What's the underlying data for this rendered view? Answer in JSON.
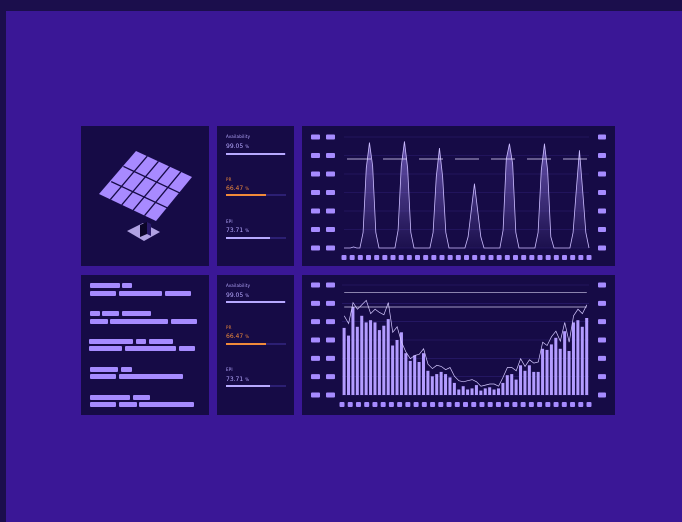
{
  "metrics_top": [
    {
      "label": "Availability",
      "value": "99.05",
      "unit": "%",
      "fraction": 0.9905,
      "accent": "#b7a9ff"
    },
    {
      "label": "PR",
      "value": "66.47",
      "unit": "%",
      "fraction": 0.6647,
      "accent": "#f08a3a"
    },
    {
      "label": "EPI",
      "value": "73.71",
      "unit": "%",
      "fraction": 0.7371,
      "accent": "#b7a9ff"
    }
  ],
  "metrics_bottom": [
    {
      "label": "Availability",
      "value": "99.05",
      "unit": "%",
      "fraction": 0.9905,
      "accent": "#b7a9ff"
    },
    {
      "label": "PR",
      "value": "66.47",
      "unit": "%",
      "fraction": 0.6647,
      "accent": "#f08a3a"
    },
    {
      "label": "EPI",
      "value": "73.71",
      "unit": "%",
      "fraction": 0.7371,
      "accent": "#b7a9ff"
    }
  ],
  "colors": {
    "background": "#3a1796",
    "panel": "#160b46",
    "accent": "#a68bff",
    "orange": "#f08a3a"
  },
  "icons": {
    "solar_array": "solar-panel-array-icon"
  },
  "chart_data": [
    {
      "type": "area",
      "series": [
        {
          "values": [
            0,
            0,
            0,
            1,
            0,
            0,
            14,
            72,
            95,
            74,
            14,
            0,
            0,
            0,
            0,
            0,
            0,
            16,
            74,
            96,
            72,
            14,
            0,
            0,
            0,
            0,
            0,
            0,
            14,
            64,
            90,
            64,
            14,
            0,
            0,
            0,
            0,
            0,
            0,
            10,
            34,
            58,
            34,
            10,
            0,
            0,
            0,
            0,
            0,
            0,
            16,
            80,
            94,
            76,
            14,
            0,
            0,
            0,
            0,
            0,
            0,
            14,
            70,
            94,
            70,
            10,
            0,
            0,
            0,
            0,
            0,
            0,
            14,
            52,
            88,
            52,
            14,
            0
          ]
        }
      ],
      "y_ticks_count": 7,
      "x_ticks_count": 31
    },
    {
      "type": "bar",
      "series": [
        {
          "type": "bar",
          "values": [
            61,
            54,
            80,
            62,
            72,
            66,
            68,
            66,
            59,
            63,
            69,
            45,
            50,
            57,
            38,
            31,
            36,
            30,
            38,
            22,
            17,
            19,
            21,
            19,
            16,
            11,
            5,
            8,
            5,
            6,
            9,
            4,
            6,
            7,
            5,
            6,
            11,
            18,
            19,
            14,
            27,
            22,
            27,
            21,
            21,
            42,
            41,
            46,
            52,
            42,
            58,
            40,
            66,
            68,
            62,
            70
          ]
        },
        {
          "type": "line",
          "values": [
            72,
            65,
            84,
            78,
            82,
            86,
            74,
            78,
            75,
            73,
            84,
            57,
            62,
            48,
            39,
            33,
            36,
            37,
            42,
            28,
            24,
            27,
            26,
            23,
            25,
            17,
            13,
            12,
            13,
            14,
            12,
            8,
            9,
            10,
            10,
            8,
            16,
            25,
            25,
            22,
            33,
            26,
            32,
            29,
            30,
            48,
            45,
            53,
            58,
            49,
            66,
            48,
            72,
            78,
            74,
            82
          ]
        },
        {
          "type": "line",
          "values": [
            93,
            93,
            93,
            93,
            93,
            93,
            93,
            93,
            93,
            93,
            93,
            93,
            93,
            93,
            93,
            93,
            93,
            93,
            93,
            93,
            93,
            93,
            93,
            93,
            93,
            93,
            93,
            93,
            93,
            93,
            93,
            93,
            93,
            93,
            93,
            93,
            93,
            93,
            93,
            93,
            93,
            93,
            93,
            93,
            93,
            93,
            93,
            93,
            93,
            93,
            93,
            93,
            93,
            93,
            93,
            93
          ]
        },
        {
          "type": "line",
          "values": [
            80,
            80,
            80,
            80,
            80,
            80,
            80,
            80,
            80,
            80,
            80,
            80,
            80,
            80,
            80,
            80,
            80,
            80,
            80,
            80,
            80,
            80,
            80,
            80,
            80,
            80,
            80,
            80,
            80,
            80,
            80,
            80,
            80,
            80,
            80,
            80,
            80,
            80,
            80,
            80,
            80,
            80,
            80,
            80,
            80,
            80,
            80,
            80,
            80,
            80,
            80,
            80,
            80,
            80,
            80,
            80
          ]
        }
      ],
      "y_ticks_count": 7,
      "x_ticks_count": 31
    }
  ]
}
